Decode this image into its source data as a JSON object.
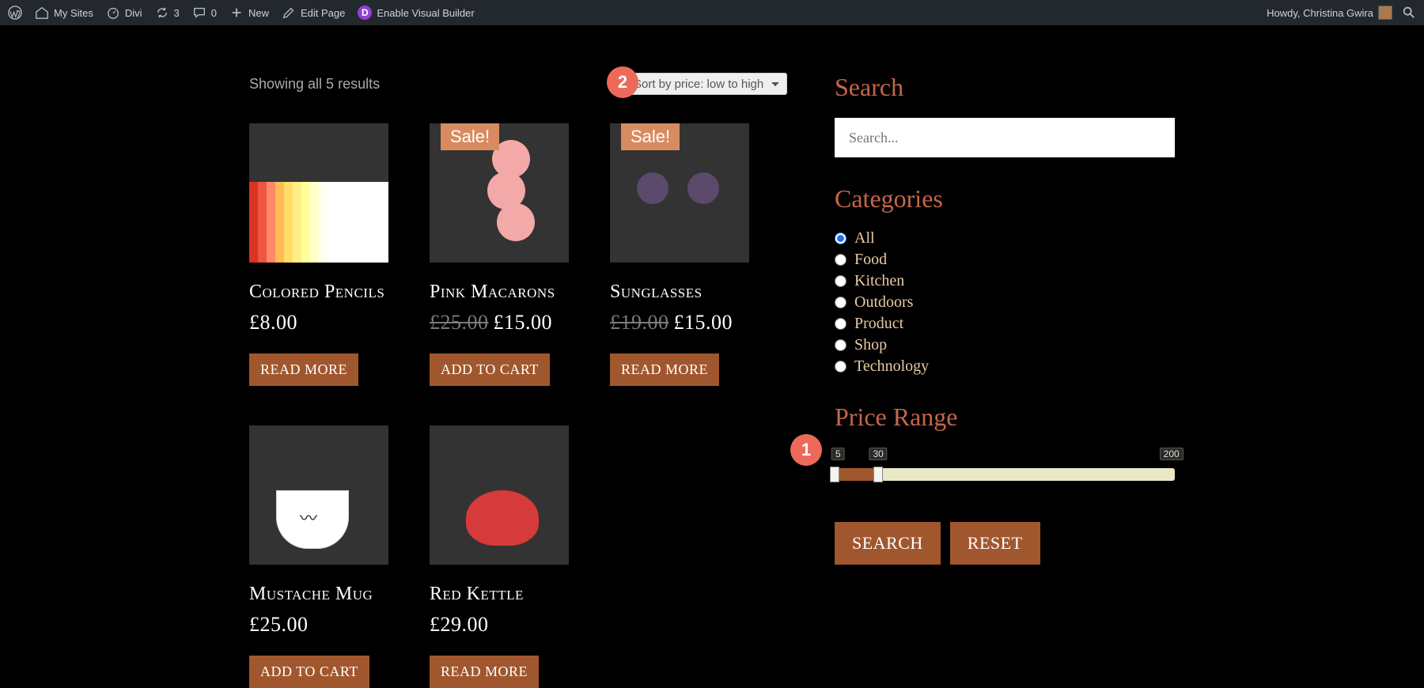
{
  "adminbar": {
    "mysites": "My Sites",
    "divi": "Divi",
    "updates_count": "3",
    "comments_count": "0",
    "new": "New",
    "edit_page": "Edit Page",
    "vb": "Enable Visual Builder",
    "howdy": "Howdy, Christina Gwira"
  },
  "annotations": {
    "a1": "1",
    "a2": "2"
  },
  "results_text": "Showing all 5 results",
  "sort_selected": "Sort by price: low to high",
  "sale_label": "Sale!",
  "products": [
    {
      "title": "Colored Pencils",
      "old": "",
      "price": "£8.00",
      "btn": "READ MORE",
      "sale": false,
      "imgcls": "img-pencils"
    },
    {
      "title": "Pink Macarons",
      "old": "£25.00",
      "price": "£15.00",
      "btn": "ADD TO CART",
      "sale": true,
      "imgcls": "img-macarons"
    },
    {
      "title": "Sunglasses",
      "old": "£19.00",
      "price": "£15.00",
      "btn": "READ MORE",
      "sale": true,
      "imgcls": "img-sunglasses"
    },
    {
      "title": "Mustache Mug",
      "old": "",
      "price": "£25.00",
      "btn": "ADD TO CART",
      "sale": false,
      "imgcls": "img-mug"
    },
    {
      "title": "Red Kettle",
      "old": "",
      "price": "£29.00",
      "btn": "READ MORE",
      "sale": false,
      "imgcls": "img-kettle"
    }
  ],
  "sidebar": {
    "search_heading": "Search",
    "search_placeholder": "Search...",
    "categories_heading": "Categories",
    "categories": [
      "All",
      "Food",
      "Kitchen",
      "Outdoors",
      "Product",
      "Shop",
      "Technology"
    ],
    "selected_category": 0,
    "price_heading": "Price Range",
    "price_min_label": "5",
    "price_cur_label": "30",
    "price_max_label": "200",
    "price_min": 5,
    "price_cur": 30,
    "price_max": 200,
    "search_btn": "SEARCH",
    "reset_btn": "RESET"
  }
}
